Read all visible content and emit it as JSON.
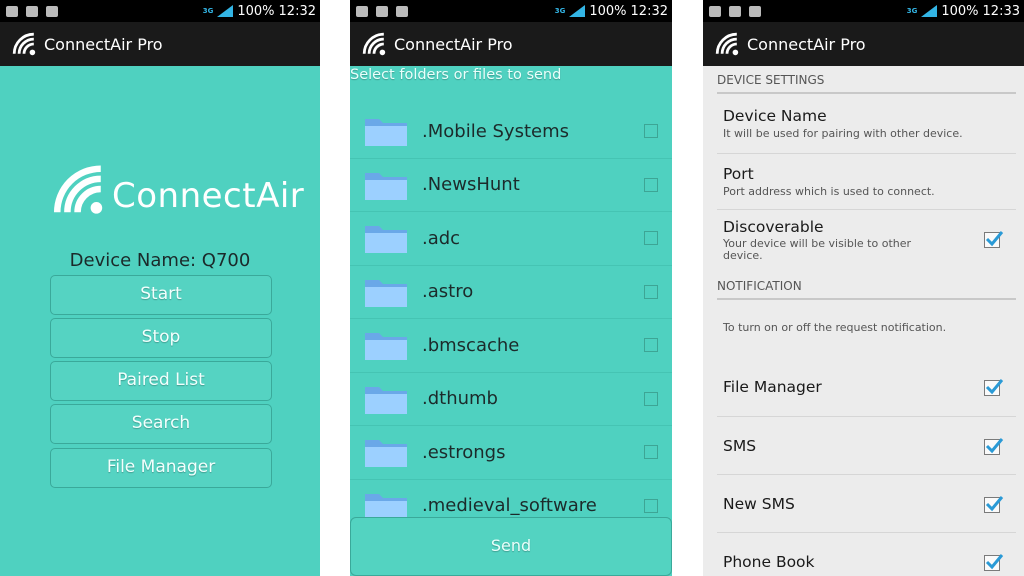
{
  "status_bar": {
    "network": "3G",
    "battery": "100%",
    "time": "12:32",
    "time_screen3": "12:33"
  },
  "app": {
    "title": "ConnectAir Pro",
    "logo_text": "ConnectAir"
  },
  "screen1": {
    "device_name": "Device Name: Q700",
    "buttons": [
      "Start",
      "Stop",
      "Paired List",
      "Search",
      "File Manager"
    ]
  },
  "screen2": {
    "hint": "Select folders or files to send",
    "folders": [
      ".Mobile Systems",
      ".NewsHunt",
      ".adc",
      ".astro",
      ".bmscache",
      ".dthumb",
      ".estrongs",
      ".medieval_software"
    ],
    "send_label": "Send"
  },
  "screen3": {
    "device_settings_header": "DEVICE SETTINGS",
    "device_name_title": "Device Name",
    "device_name_summary": "It will be used for pairing with other device.",
    "port_title": "Port",
    "port_summary": "Port address which is used to connect.",
    "discoverable_title": "Discoverable",
    "discoverable_summary": "Your device will be visible to other device.",
    "notification_header": "NOTIFICATION",
    "notification_summary": "To turn on or off the request notification.",
    "file_manager": "File Manager",
    "sms": "SMS",
    "new_sms": "New SMS",
    "phone_book": "Phone Book"
  },
  "colors": {
    "teal": "#4fd1c0",
    "action_bar": "#1a1a1a",
    "check_blue": "#2a9ad6"
  }
}
